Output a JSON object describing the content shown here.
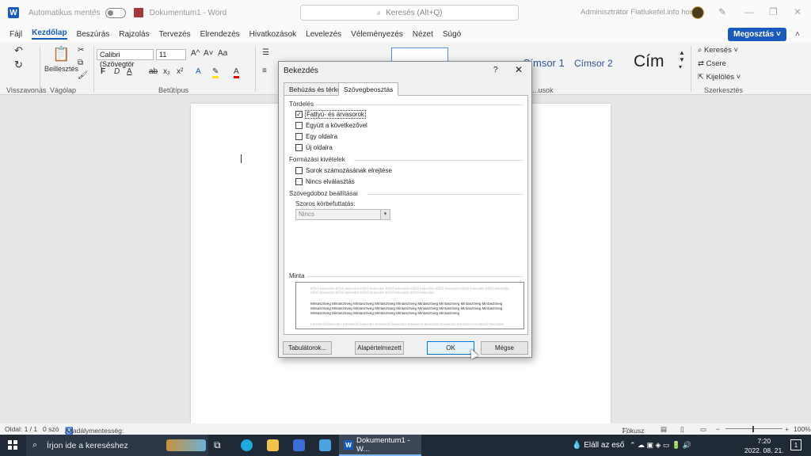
{
  "titlebar": {
    "autosave": "Automatikus mentés",
    "doc_title": "Dokumentum1 - Word",
    "search_placeholder": "Keresés (Alt+Q)",
    "user": "Adminisztrátor Fiatlukefel.info honlap"
  },
  "menu": [
    "Fájl",
    "Kezdőlap",
    "Beszúrás",
    "Rajzolás",
    "Tervezés",
    "Elrendezés",
    "Hivatkozások",
    "Levelezés",
    "Véleményezés",
    "Nézet",
    "Súgó"
  ],
  "share_label": "Megosztás",
  "ribbon": {
    "paste": "Beillesztés",
    "font_name": "Calibri (Szövegtör",
    "font_size": "11",
    "grow": "A^",
    "shrink": "A˅",
    "case": "Aa",
    "bold": "F",
    "italic": "D",
    "underline": "A",
    "strike": "ab",
    "sub": "x₂",
    "sup": "x²",
    "style1": "Címsor 1",
    "style2": "Címsor 2",
    "style3": "Cím",
    "find": "Keresés",
    "replace": "Csere",
    "select": "Kijelölés",
    "groups": {
      "undo": "Visszavonás",
      "clipboard": "Vágólap",
      "font": "Betűtípus",
      "styles": "...usok",
      "editing": "Szerkesztés"
    }
  },
  "dialog": {
    "title": "Bekezdés",
    "help": "?",
    "close": "✕",
    "tabs": [
      "Behúzás és térköz",
      "Szövegbeosztás"
    ],
    "section_break": "Tördelés",
    "checkboxes_break": [
      {
        "label": "Fattyú- és árvasorok",
        "checked": true
      },
      {
        "label": "Együtt a következővel",
        "checked": false
      },
      {
        "label": "Egy oldalra",
        "checked": false
      },
      {
        "label": "Új oldalra",
        "checked": false
      }
    ],
    "section_format": "Formázási kivételek",
    "checkboxes_format": [
      {
        "label": "Sorok számozásának elrejtése",
        "checked": false
      },
      {
        "label": "Nincs elválasztás",
        "checked": false
      }
    ],
    "section_textbox": "Szövegdoboz beállításai",
    "wrap_label": "Szoros körbefuttatás:",
    "wrap_value": "Nincs",
    "section_preview": "Minta",
    "preview_prev": "Előző bekezdés Előző bekezdés Előző bekezdés Előző bekezdés Előző bekezdés Előző bekezdés Előző bekezdés Előző bekezdés Előző bekezdés Előző bekezdés Előző bekezdés Előző bekezdés Előző bekezdés",
    "preview_main": "Mintaszöveg Mintaszöveg Mintaszöveg Mintaszöveg Mintaszöveg Mintaszöveg Mintaszöveg Mintaszöveg Mintaszöveg Mintaszöveg Mintaszöveg Mintaszöveg Mintaszöveg Mintaszöveg Mintaszöveg Mintaszöveg Mintaszöveg Mintaszöveg Mintaszöveg Mintaszöveg Mintaszöveg Mintaszöveg Mintaszöveg Mintaszöveg Mintaszöveg",
    "preview_next": "Következő bekezdés Következő bekezdés Következő bekezdés Következő bekezdés Következő bekezdés Következő bekezdés",
    "buttons": {
      "tabs": "Tabulátorok...",
      "default": "Alapértelmezett",
      "ok": "OK",
      "cancel": "Mégse"
    }
  },
  "status": {
    "page": "Oldal: 1 / 1",
    "words": "0 szó",
    "accessibility": "Akadálymentesség: minden rendben",
    "focus": "Fókusz",
    "zoom": "100%"
  },
  "taskbar": {
    "search": "Írjon ide a kereséshez",
    "word_app": "Dokumentum1 - W...",
    "weather": "Eláll az eső",
    "time": "7:20",
    "date": "2022. 08. 21.",
    "notif": "1"
  }
}
